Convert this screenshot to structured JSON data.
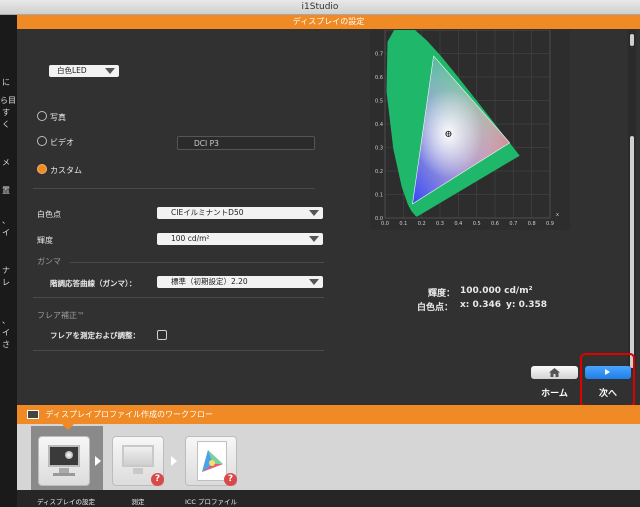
{
  "window": {
    "title": "i1Studio"
  },
  "left_strip": {
    "fragments": [
      "に",
      "ら目",
      "す",
      "く",
      "メ",
      "置",
      "、",
      "イ",
      "ナ",
      "レ",
      "、",
      "イ",
      "さ"
    ]
  },
  "header": {
    "title": "ディスプレイの設定"
  },
  "display_type": {
    "value": "白色LED"
  },
  "targets": {
    "photo_label": "写真",
    "video_label": "ビデオ",
    "custom_label": "カスタム",
    "selected": "カスタム",
    "video_standard": "DCI P3"
  },
  "settings": {
    "whitepoint_label": "白色点",
    "whitepoint_value": "CIEイルミナントD50",
    "luminance_label": "輝度",
    "luminance_value": "100 cd/m²",
    "gamma_section": "ガンマ",
    "gamma_label": "階調応答曲線（ガンマ）：",
    "gamma_value": "標準（初期設定）2.20",
    "flare_section": "フレア補正™",
    "flare_label": "フレアを測定および調整：",
    "flare_checked": false
  },
  "chart_data": {
    "type": "scatter",
    "x_ticks": [
      "0.0",
      "0.1",
      "0.2",
      "0.3",
      "0.4",
      "0.5",
      "0.6",
      "0.7",
      "0.8",
      "0.9"
    ],
    "y_ticks": [
      "0.0",
      "0.1",
      "0.2",
      "0.3",
      "0.4",
      "0.5",
      "0.6",
      "0.7"
    ],
    "xlabel": "x",
    "xlim": [
      0,
      0.9
    ],
    "ylim": [
      0,
      0.8
    ],
    "gamut": [
      [
        0.68,
        0.32
      ],
      [
        0.265,
        0.69
      ],
      [
        0.15,
        0.06
      ]
    ],
    "whitepoint": [
      0.346,
      0.358
    ],
    "grid": true
  },
  "readout": {
    "luminance_label": "輝度：",
    "luminance_value": "100.000 cd/m²",
    "whitepoint_label": "白色点：",
    "x_value": "x: 0.346",
    "y_value": "y: 0.358"
  },
  "nav": {
    "home_label": "ホーム",
    "next_label": "次へ"
  },
  "workflow": {
    "title": "ディスプレイプロファイル作成のワークフロー",
    "steps": [
      {
        "label": "ディスプレイの設定"
      },
      {
        "label": "測定"
      },
      {
        "label": "ICC プロファイル"
      }
    ]
  },
  "colors": {
    "accent": "#f08a24",
    "next_button": "#2a8ff0",
    "highlight": "#e00000"
  }
}
